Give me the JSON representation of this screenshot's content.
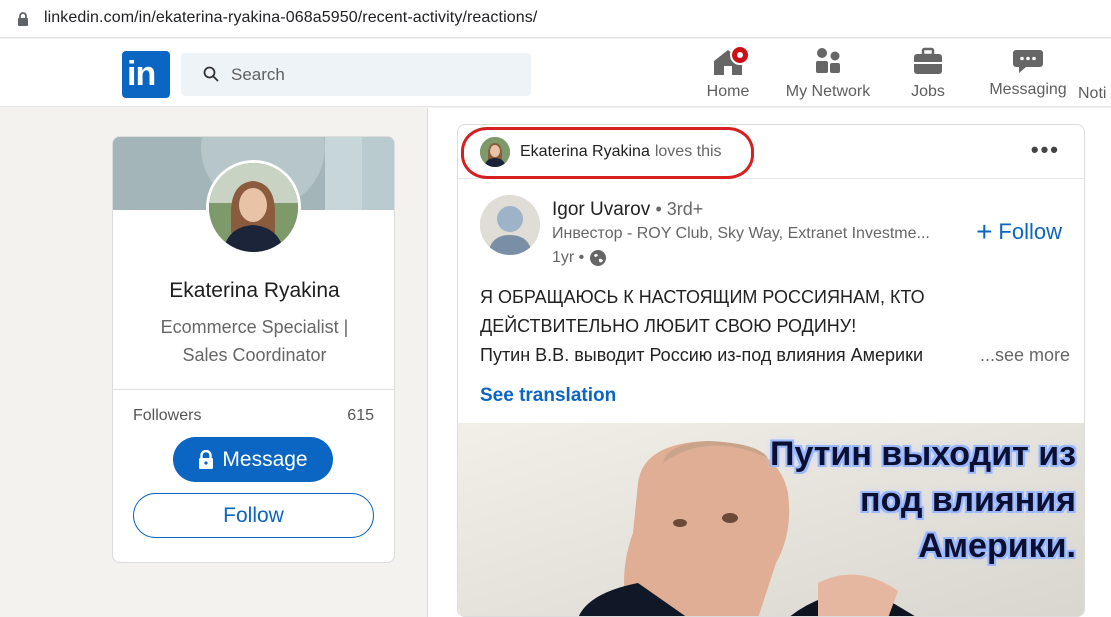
{
  "browser": {
    "url": "linkedin.com/in/ekaterina-ryakina-068a5950/recent-activity/reactions/"
  },
  "nav": {
    "logo_text": "in",
    "search_placeholder": "Search",
    "items": [
      {
        "label": "Home",
        "icon": "home-icon"
      },
      {
        "label": "My Network",
        "icon": "network-icon"
      },
      {
        "label": "Jobs",
        "icon": "briefcase-icon"
      },
      {
        "label": "Messaging",
        "icon": "messaging-icon"
      },
      {
        "label": "Noti",
        "icon": "bell-icon"
      }
    ],
    "brand_color": "#0a66c2",
    "badge_color": "#cc1016"
  },
  "profile": {
    "name": "Ekaterina Ryakina",
    "headline": "Ecommerce Specialist | Sales Coordinator",
    "followers_label": "Followers",
    "followers_count": "615",
    "message_button": "Message",
    "follow_button": "Follow"
  },
  "feed": {
    "reactor_name": "Ekaterina Ryakina",
    "reaction_text": "loves this",
    "more_label": "•••",
    "author": {
      "name": "Igor Uvarov",
      "degree": "• 3rd+",
      "title": "Инвестор - ROY Club, Sky Way, Extranet Investme...",
      "time": "1yr •"
    },
    "follow_label": "Follow",
    "post_line1": "Я ОБРАЩАЮСЬ К НАСТОЯЩИМ РОССИЯНАМ, КТО",
    "post_line2": "ДЕЙСТВИТЕЛЬНО ЛЮБИТ СВОЮ РОДИНУ!",
    "post_line3": "Путин В.В. выводит Россию из-под влияния Америки",
    "see_more": "...see more",
    "see_translation": "See translation",
    "image_caption_1": "Путин выходит из",
    "image_caption_2": "под влияния",
    "image_caption_3": "Америки."
  }
}
